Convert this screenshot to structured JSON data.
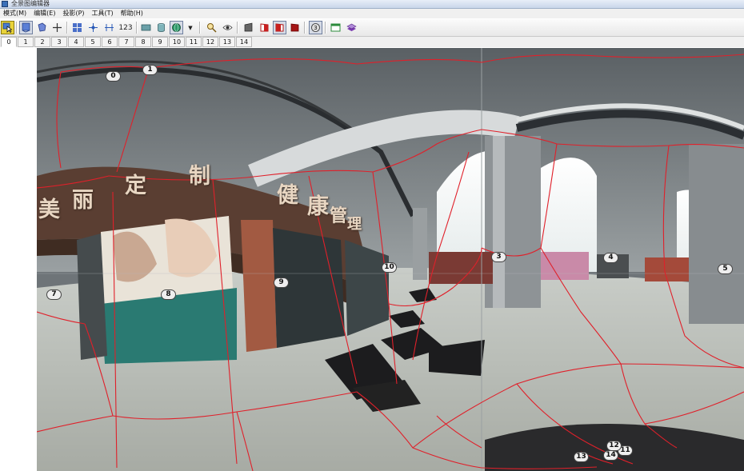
{
  "window": {
    "title": "全景图编辑器"
  },
  "menu": [
    {
      "label": "模式(M)"
    },
    {
      "label": "编辑(E)"
    },
    {
      "label": "投影(P)"
    },
    {
      "label": "工具(T)"
    },
    {
      "label": "帮助(H)"
    }
  ],
  "toolbar": {
    "counter_label": "123",
    "dropdown_glyph": "▼",
    "badge_label": "3",
    "buttons": [
      "select-arrow-icon",
      "view-panorama-icon",
      "polygon-icon",
      "crosshair-add-icon",
      "grid-select-icon",
      "move-point-icon",
      "align-horizontal-icon",
      "numbering-icon",
      "plane-projection-icon",
      "cylinder-projection-icon",
      "sphere-projection-icon",
      "projection-dropdown-icon",
      "zoom-icon",
      "eye-preview-icon",
      "face-gray-icon",
      "face-red-outline-icon",
      "face-red-active-icon",
      "face-red-filled-icon",
      "numbered-badge-icon",
      "window-layout-icon",
      "layers-stack-icon"
    ]
  },
  "tabs": [
    "0",
    "1",
    "2",
    "3",
    "4",
    "5",
    "6",
    "7",
    "8",
    "9",
    "10",
    "11",
    "12",
    "13",
    "14"
  ],
  "selected_tab": "0",
  "panorama": {
    "sign_text": [
      "美",
      "丽",
      "定",
      "制",
      "健",
      "康",
      "管",
      "理"
    ],
    "segment_line_color": "#e0202a",
    "segment_markers": [
      "0",
      "1",
      "3",
      "4",
      "5",
      "7",
      "8",
      "9",
      "10",
      "11",
      "12",
      "13",
      "14"
    ]
  }
}
